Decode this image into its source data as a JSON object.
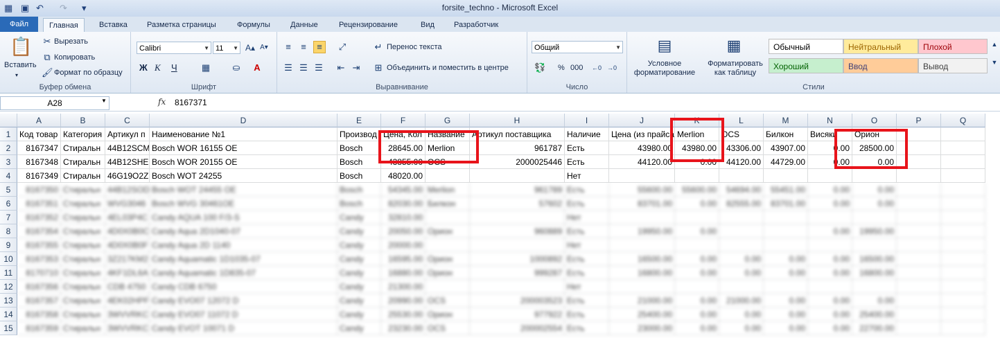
{
  "window": {
    "title": "forsite_techno  -  Microsoft Excel"
  },
  "tabs": [
    "Файл",
    "Главная",
    "Вставка",
    "Разметка страницы",
    "Формулы",
    "Данные",
    "Рецензирование",
    "Вид",
    "Разработчик"
  ],
  "ribbon": {
    "clipboard": {
      "paste": "Вставить",
      "cut": "Вырезать",
      "copy": "Копировать",
      "format_painter": "Формат по образцу",
      "label": "Буфер обмена"
    },
    "font": {
      "name": "Calibri",
      "size": "11",
      "bold": "Ж",
      "italic": "К",
      "underline": "Ч",
      "label": "Шрифт"
    },
    "alignment": {
      "wrap": "Перенос текста",
      "merge": "Объединить и поместить в центре",
      "label": "Выравнивание"
    },
    "number": {
      "format": "Общий",
      "percent": "%",
      "thousands": "000",
      "label": "Число"
    },
    "styles": {
      "conditional": "Условное форматирование",
      "as_table": "Форматировать как таблицу",
      "cells": [
        {
          "name": "Обычный",
          "bg": "#ffffff",
          "fg": "#000000"
        },
        {
          "name": "Нейтральный",
          "bg": "#ffeb9c",
          "fg": "#9c6500"
        },
        {
          "name": "Плохой",
          "bg": "#ffc7ce",
          "fg": "#9c0006"
        },
        {
          "name": "Хороший",
          "bg": "#c6efce",
          "fg": "#006100"
        },
        {
          "name": "Ввод",
          "bg": "#ffcc99",
          "fg": "#3f3f76"
        },
        {
          "name": "Вывод",
          "bg": "#f2f2f2",
          "fg": "#3f3f3f"
        }
      ],
      "label": "Стили"
    }
  },
  "formula_bar": {
    "name_box": "A28",
    "fx": "fx",
    "value": "8167371"
  },
  "columns": [
    "A",
    "B",
    "C",
    "D",
    "E",
    "F",
    "G",
    "H",
    "I",
    "J",
    "K",
    "L",
    "M",
    "N",
    "O",
    "P",
    "Q"
  ],
  "rows": [
    [
      "Код товар",
      "Категория",
      "Артикул п",
      "Наименование №1",
      "Производ",
      "Цена, Кол",
      "Название",
      "Артикул поставщика",
      "Наличие",
      "Цена (из прайса)",
      "Merlion",
      "OCS",
      "Билкон",
      "Висяки",
      "Орион",
      "",
      ""
    ],
    [
      "8167347",
      "Стиральн",
      "44B12SCM",
      "Bosch WOR 16155 OE",
      "Bosch",
      "28645.00",
      "Merlion",
      "961787",
      "Есть",
      "43980.00",
      "43980.00",
      "43306.00",
      "43907.00",
      "0.00",
      "28500.00",
      "",
      ""
    ],
    [
      "8167348",
      "Стиральн",
      "44B12SHE",
      "Bosch WOR 20155 OE",
      "Bosch",
      "43855.00",
      "OCS",
      "2000025446",
      "Есть",
      "44120.00",
      "0.00",
      "44120.00",
      "44729.00",
      "0.00",
      "0.00",
      "",
      ""
    ],
    [
      "8167349",
      "Стиральн",
      "46G19O2Z",
      "Bosch WOT 24255",
      "Bosch",
      "48020.00",
      "",
      "",
      "Нет",
      "",
      "",
      "",
      "",
      "",
      "",
      "",
      ""
    ],
    [
      "8167350",
      "Стиральн",
      "44B12SOD",
      "Bosch WOT 24455 OE",
      "Bosch",
      "54345.00",
      "Merlion",
      "961789",
      "Есть",
      "55600.00",
      "55600.00",
      "54694.00",
      "55451.00",
      "0.00",
      "0.00",
      "",
      ""
    ],
    [
      "8167351",
      "Стиральн",
      "WVG3046",
      "Bosch WVG 30461OE",
      "Bosch",
      "82030.00",
      "Билкон",
      "57602",
      "Есть",
      "83701.00",
      "0.00",
      "82555.00",
      "83701.00",
      "0.00",
      "0.00",
      "",
      ""
    ],
    [
      "8167352",
      "Стиральн",
      "4EL03P4C",
      "Candy AQUA 100 F/3-S",
      "Candy",
      "32810.00",
      "",
      "",
      "Нет",
      "",
      "",
      "",
      "",
      "",
      "",
      "",
      ""
    ],
    [
      "8167354",
      "Стиральн",
      "4D0X0B0C",
      "Candy Aqua 2D1040-07",
      "Candy",
      "20050.00",
      "Орион",
      "960889",
      "Есть",
      "19950.00",
      "0.00",
      "",
      "",
      "0.00",
      "19950.00",
      "",
      ""
    ],
    [
      "8167355",
      "Стиральн",
      "4D0X0B0F",
      "Candy Aqua 2D 1140",
      "Candy",
      "20000.00",
      "",
      "",
      "Нет",
      "",
      "",
      "",
      "",
      "",
      "",
      "",
      ""
    ],
    [
      "8167353",
      "Стиральн",
      "3Z217KM2",
      "Candy Aquamatic 1D1035-07",
      "Candy",
      "16595.00",
      "Орион",
      "1000892",
      "Есть",
      "16500.00",
      "0.00",
      "0.00",
      "0.00",
      "0.00",
      "16500.00",
      "",
      ""
    ],
    [
      "8170710",
      "Стиральн",
      "4KF1DL6A",
      "Candy Aquamatic 1D835-07",
      "Candy",
      "16880.00",
      "Орион",
      "999287",
      "Есть",
      "16800.00",
      "0.00",
      "0.00",
      "0.00",
      "0.00",
      "16800.00",
      "",
      ""
    ],
    [
      "8167356",
      "Стиральн",
      "CDB 4750",
      "Candy CDB 6750",
      "Candy",
      "21300.00",
      "",
      "",
      "Нет",
      "",
      "",
      "",
      "",
      "",
      "",
      "",
      ""
    ],
    [
      "8167357",
      "Стиральн",
      "4EK02HPF",
      "Candy EVO07 12072 D",
      "Candy",
      "20990.00",
      "OCS",
      "200003523",
      "Есть",
      "21000.00",
      "0.00",
      "21000.00",
      "0.00",
      "0.00",
      "0.00",
      "",
      ""
    ],
    [
      "8167358",
      "Стиральн",
      "3WVVRKC",
      "Candy EVO07 11072 D",
      "Candy",
      "25530.00",
      "Орион",
      "977922",
      "Есть",
      "25400.00",
      "0.00",
      "0.00",
      "0.00",
      "0.00",
      "25400.00",
      "",
      ""
    ],
    [
      "8167359",
      "Стиральн",
      "3WVVRKC",
      "Candy EVOT 10071 D",
      "Candy",
      "23230.00",
      "OCS",
      "200002554",
      "Есть",
      "23000.00",
      "0.00",
      "0.00",
      "0.00",
      "0.00",
      "22700.00",
      "",
      ""
    ]
  ]
}
